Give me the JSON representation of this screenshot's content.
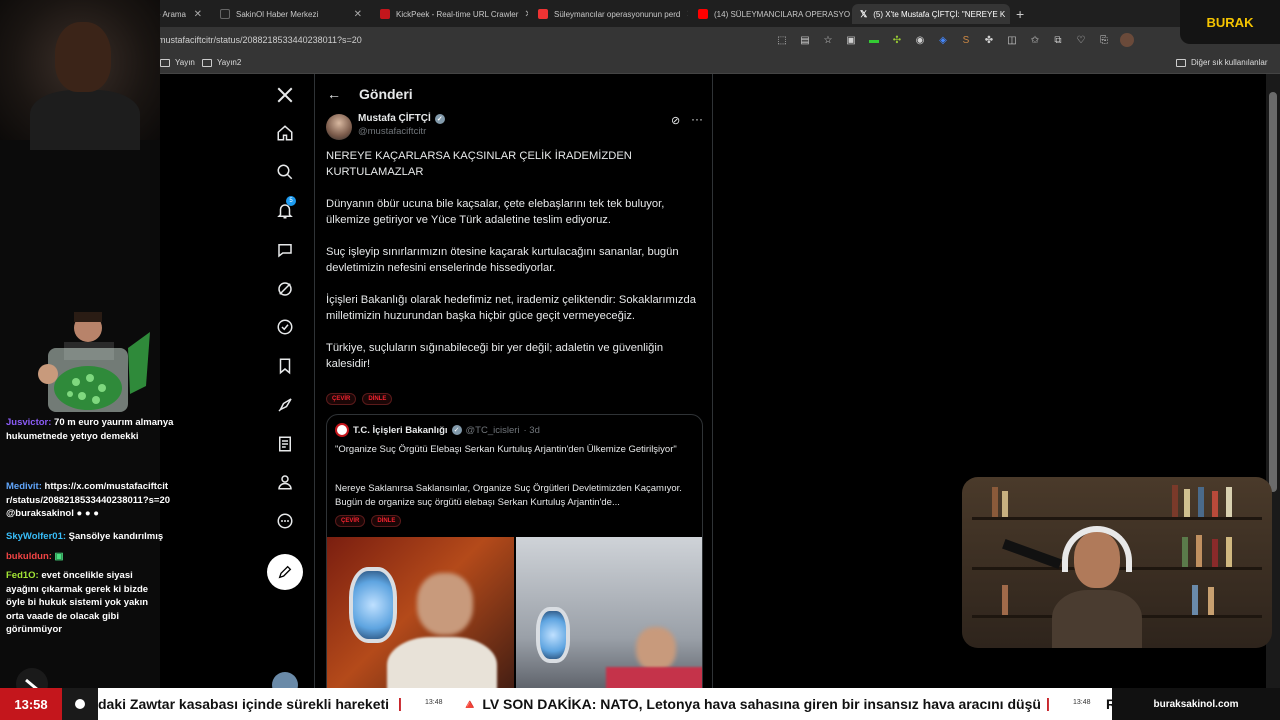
{
  "browser": {
    "tabs": [
      {
        "label": "- Arama",
        "color": "#4285f4"
      },
      {
        "label": "SakinOl Haber Merkezi",
        "color": "#222"
      },
      {
        "label": "KickPeek - Real-time URL Crawler",
        "color": "#c4161c"
      },
      {
        "label": "Süleymancılar operasyonunun perd",
        "color": "#e33"
      },
      {
        "label": "(14) SÜLEYMANCILARA OPERASYO",
        "color": "#f00"
      },
      {
        "label": "(5) X'te Mustafa ÇİFTÇİ: \"NEREYE K",
        "color": "#111"
      }
    ],
    "url": "mustafaciftcitr/status/2088218533440238011?s=20",
    "bookmarks": [
      "Yayın",
      "Yayın2"
    ],
    "bookmarks_right": "Diğer sık kullanılanlar"
  },
  "brand": "BURAK",
  "chat": [
    {
      "user": "Jusvictor:",
      "text": " 70 m euro yaurım almanya hukumetnede yetıyo demekki",
      "color": "#8b5cf6"
    },
    {
      "user": "Medivit:",
      "text": " https://x.com/mustafaciftcitr/status/2088218533440238011?s=20 @buraksakinol ● ● ●",
      "color": "#60a5fa"
    },
    {
      "user": "SkyWolfer01:",
      "text": " Şansölye kandırılmış",
      "color": "#38bdf8"
    },
    {
      "user": "bukuldun:",
      "text": " ▣",
      "color": "#ef4444"
    },
    {
      "user": "Fed1O:",
      "text": " evet öncelikle siyasi ayağını çıkarmak gerek ki bizde öyle bi hukuk sistemi yok yakın orta vaade de olacak gibi görünmüyor",
      "color": "#a3e635"
    }
  ],
  "tweet": {
    "header": "Gönderi",
    "author": "Mustafa ÇİFTÇİ",
    "handle": "@mustafaciftcitr",
    "paragraphs": [
      "NEREYE KAÇARLARSA KAÇSINLAR ÇELİK İRADEMİZDEN KURTULAMAZLAR",
      "Dünyanın öbür ucuna bile kaçsalar, çete elebaşlarını tek tek buluyor, ülkemize getiriyor ve Yüce Türk adaletine teslim ediyoruz.",
      "Suç işleyip sınırlarımızın ötesine kaçarak kurtulacağını sananlar, bugün devletimizin nefesini enselerinde hissediyorlar.",
      "İçişleri Bakanlığı olarak hedefimiz net, irademiz çeliktendir: Sokaklarımızda milletimizin huzurundan başka hiçbir güce geçit vermeyeceğiz.",
      "Türkiye, suçluların sığınabileceği bir yer değil; adaletin ve güvenliğin kalesidir!"
    ],
    "translate": "ÇEVİR",
    "listen": "DİNLE",
    "notif_count": "5",
    "quote": {
      "name": "T.C. İçişleri Bakanlığı",
      "handle": "@TC_icisleri",
      "time": "· 3d",
      "title": "\"Organize Suç Örgütü Elebaşı Serkan Kurtuluş Arjantin'den Ülkemize Getirilşiyor\"",
      "text": "Nereye Saklanırsa Saklansınlar, Organize Suç Örgütleri Devletimizden Kaçamıyor. Bugün de organize suç örgütü elebaşı Serkan Kurtuluş Arjantin'de..."
    }
  },
  "ticker": {
    "clock": "13:58",
    "items": [
      {
        "text": "daki Zawtar kasabası içinde sürekli hareketi"
      },
      {
        "time": "13:48",
        "text": "🔺 LV SON DAKİKA: NATO, Letonya hava sahasına giren bir insansız hava aracını düşürdü"
      },
      {
        "time": "13:48",
        "text": "R"
      }
    ],
    "site": "buraksakinol.com"
  },
  "colors": {
    "accent": "#1d9bf0",
    "ticker_red": "#c4161c",
    "brand_yellow": "#f5c400"
  }
}
